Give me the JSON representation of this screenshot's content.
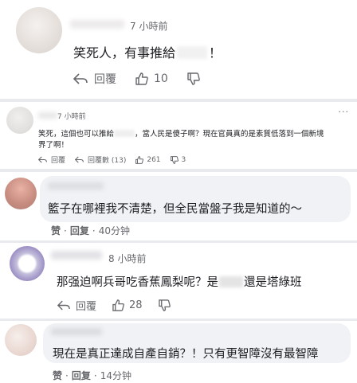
{
  "comments": [
    {
      "time": "7 小時前",
      "text_before": "笑死人，有事推給",
      "text_after": "！",
      "reply_label": "回覆",
      "like_count": "10"
    },
    {
      "time": "7 小時前",
      "text_line1_before": "笑死，這個也可以推給",
      "text_line1_after": "，當人民是傻子啊？現在官員真的是素質低落到一個新境",
      "text_line2": "界了啊！",
      "reply_label": "回覆",
      "replies_label": "回覆數 (13)",
      "like_count": "261",
      "dislike_count": "3",
      "more": "···"
    },
    {
      "text": "籃子在哪裡我不清楚，但全民當盤子我是知道的～",
      "like_label": "赞",
      "sep": "·",
      "reply_label": "回复",
      "time": "40分钟"
    },
    {
      "time": "8 小時前",
      "text_before": "那强迫啊兵哥吃香蕉鳳梨呢？是",
      "text_after": "還是塔綠班",
      "reply_label": "回覆",
      "like_count": "28"
    },
    {
      "text": "現在是真正達成自產自銷？！只有更智障沒有最智障",
      "like_label": "赞",
      "sep": "·",
      "reply_label": "回复",
      "time": "14分钟"
    }
  ]
}
